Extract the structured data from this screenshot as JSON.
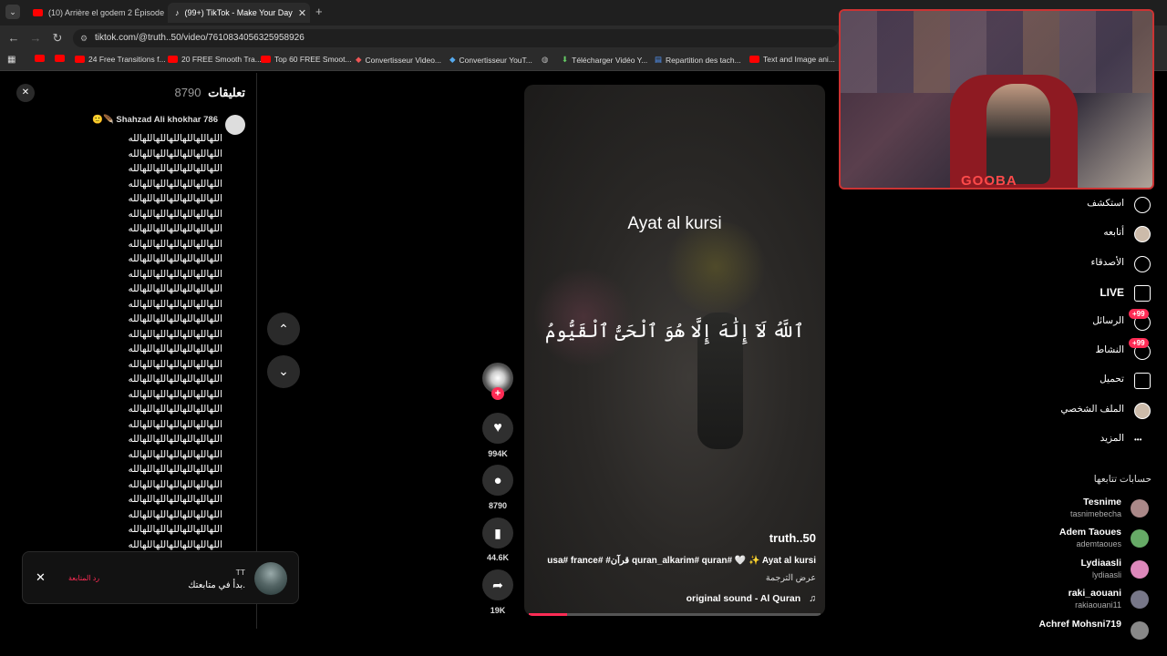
{
  "browser": {
    "tabs": [
      {
        "title": "(10) Arrière el godem 2 Épisode",
        "active": false
      },
      {
        "title": "(99+) TikTok - Make Your Day",
        "active": true
      }
    ],
    "url": "tiktok.com/@truth..50/video/7610834056325958926",
    "bookmarks": [
      "24 Free Transitions f...",
      "20 FREE Smooth Tra...",
      "Top 60 FREE Smoot...",
      "Convertisseur Video...",
      "Convertisseur YouT...",
      "Télécharger Vidéo Y...",
      "Repartition des tach...",
      "Text and Image ani..."
    ]
  },
  "comments_panel": {
    "title": "تعليقات",
    "count": "8790",
    "comment_author": "Shahzad Ali khokhar 786",
    "comment_text": "اللهاللهاللهاللهاللهاللهالله",
    "line_count": 28
  },
  "toast": {
    "name": "TT",
    "message": "بدأ في متابعتك.",
    "action": "رد المتابعة"
  },
  "video": {
    "title_overlay": "Ayat al kursi",
    "arabic_overlay": "ٱللَّهُ لَآ إِلَٰهَ إِلَّا هُوَ ٱلْحَىُّ ٱلْقَيُّومُ",
    "author": "truth..50",
    "caption": "usa# france# #قرآن quran_alkarim# quran# 🤍 ✨ Ayat al kursi",
    "translate": "عرض الترجمة",
    "sound": "original sound - Al Quran",
    "progress": 0.13
  },
  "actions": {
    "likes": "994K",
    "comments": "8790",
    "saves": "44.6K",
    "shares": "19K"
  },
  "webcam": {
    "overlay_text": "GOOBA"
  },
  "sidenav": {
    "items": [
      {
        "label": "استكشف",
        "icon": "compass-icon"
      },
      {
        "label": "أتابعه",
        "icon": "following-avatar-icon"
      },
      {
        "label": "الأصدقاء",
        "icon": "friends-icon"
      },
      {
        "label": "LIVE",
        "icon": "live-icon"
      },
      {
        "label": "الرسائل",
        "icon": "messages-icon",
        "badge": "+99"
      },
      {
        "label": "النشاط",
        "icon": "activity-icon",
        "badge": "+99"
      },
      {
        "label": "تحميل",
        "icon": "upload-icon"
      },
      {
        "label": "الملف الشخصي",
        "icon": "profile-avatar-icon"
      },
      {
        "label": "المزيد",
        "icon": "more-icon"
      }
    ],
    "following_header": "حسابات تتابعها",
    "accounts": [
      {
        "name": "Tesnime",
        "user": "tasnimebecha"
      },
      {
        "name": "Adem Taoues",
        "user": "ademtaoues"
      },
      {
        "name": "Lydiaasli",
        "user": "lydiaasli"
      },
      {
        "name": "raki_aouani",
        "user": "rakiaouani11"
      },
      {
        "name": "Achref Mohsni719",
        "user": ""
      }
    ]
  },
  "colors": {
    "accent": "#fe2c55",
    "bg": "#000000",
    "chrome": "#2b2b2b"
  }
}
